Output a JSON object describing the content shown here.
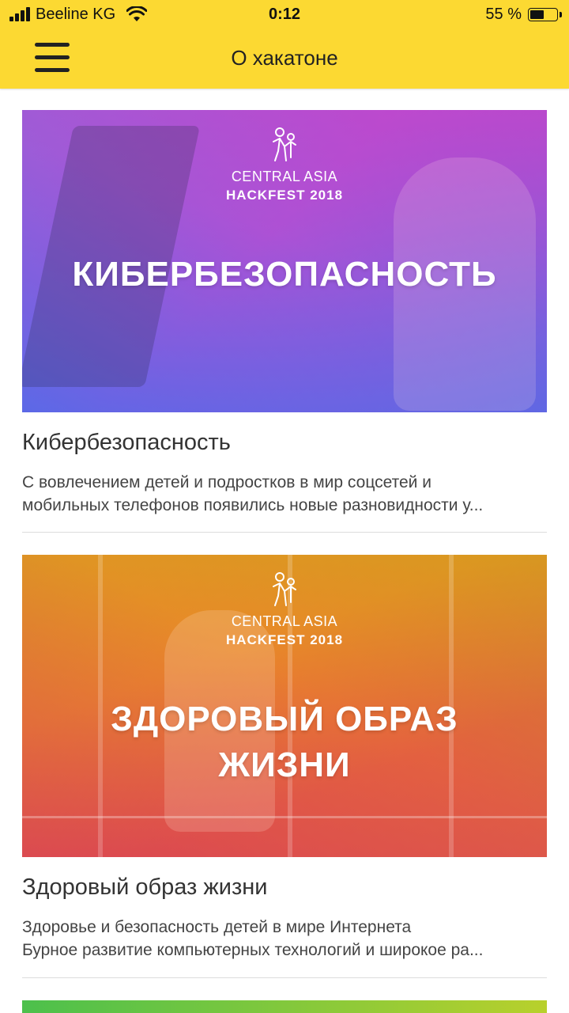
{
  "status_bar": {
    "carrier": "Beeline KG",
    "time": "0:12",
    "battery_percent": "55 %",
    "battery_level": 0.55
  },
  "header": {
    "title": "О хакатоне"
  },
  "cards": [
    {
      "banner": {
        "org_line1": "CENTRAL ASIA",
        "org_line2": "HACKFEST 2018",
        "title_line1": "КИБЕРБЕЗОПАСНОСТЬ",
        "title_line2": ""
      },
      "title": "Кибербезопасность",
      "desc_line1": "С вовлечением детей и подростков в мир соцсетей и",
      "desc_line2": "мобильных телефонов появились новые разновидности у..."
    },
    {
      "banner": {
        "org_line1": "CENTRAL ASIA",
        "org_line2": "HACKFEST 2018",
        "title_line1": "ЗДОРОВЫЙ ОБРАЗ",
        "title_line2": "ЖИЗНИ"
      },
      "title": "Здоровый образ жизни",
      "desc_line1": "Здоровье и безопасность детей в мире Интернета",
      "desc_line2": "Бурное развитие компьютерных технологий и широкое ра..."
    }
  ]
}
